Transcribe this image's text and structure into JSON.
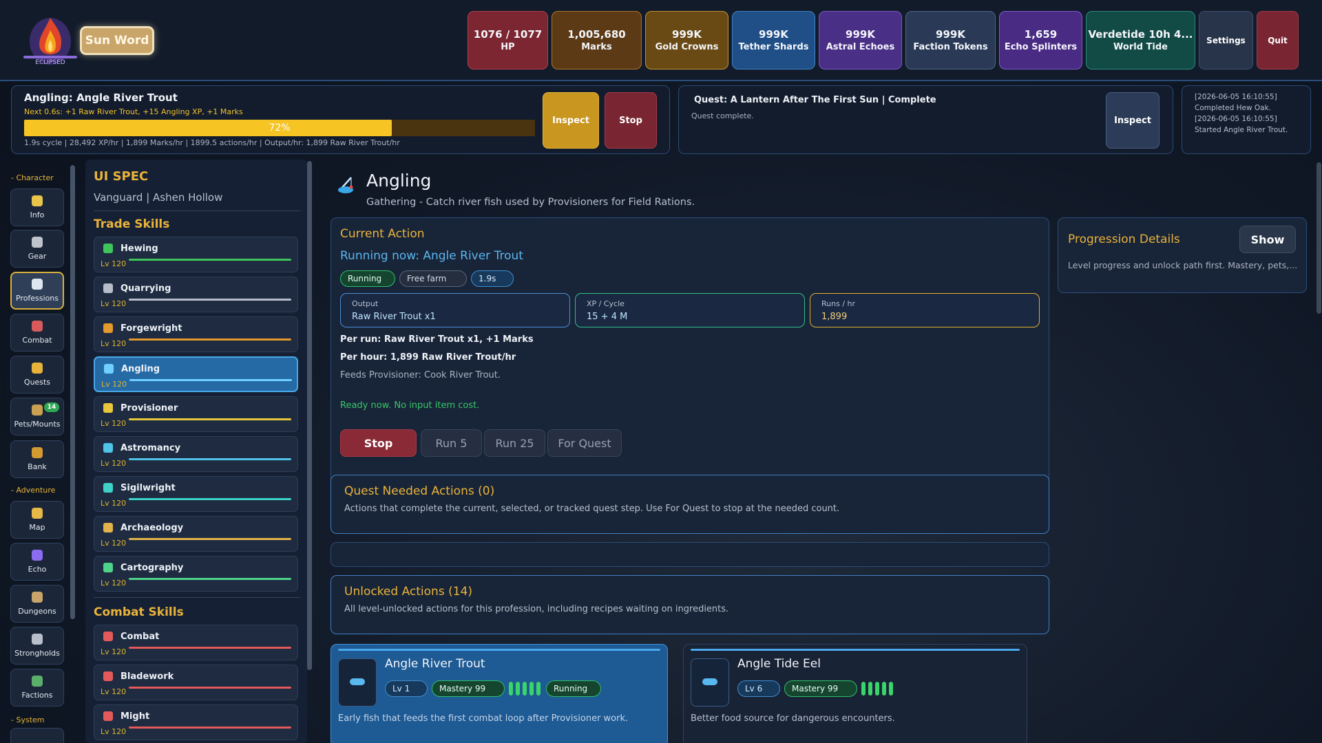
{
  "top": {
    "flame_caption": "ECLIPSED",
    "sun_button": "Sun Word",
    "stats": [
      {
        "value": "1076 / 1077",
        "label": "HP",
        "color": "#7b2630",
        "border": "#b0404e"
      },
      {
        "value": "1,005,680",
        "label": "Marks",
        "color": "#5d3a16",
        "border": "#a9742c"
      },
      {
        "value": "999K",
        "label": "Gold Crowns",
        "color": "#6a4a14",
        "border": "#c3922f"
      },
      {
        "value": "999K",
        "label": "Tether Shards",
        "color": "#1f4f86",
        "border": "#3f82c6"
      },
      {
        "value": "999K",
        "label": "Astral Echoes",
        "color": "#4a2f86",
        "border": "#7a56c8"
      },
      {
        "value": "999K",
        "label": "Faction Tokens",
        "color": "#2a3a56",
        "border": "#4e6488"
      },
      {
        "value": "1,659",
        "label": "Echo Splinters",
        "color": "#4a2b84",
        "border": "#7b59c9"
      },
      {
        "value": "Verdetide 10h 4...",
        "label": "World Tide",
        "color": "#124a45",
        "border": "#2b8b7e"
      }
    ],
    "settings": "Settings",
    "quit": "Quit"
  },
  "activity": {
    "title": "Angling: Angle River Trout",
    "next": "Next 0.6s: +1 Raw River Trout, +15 Angling XP, +1 Marks",
    "progress": 0.72,
    "progress_text": "72%",
    "stats": "1.9s cycle | 28,492 XP/hr | 1,899 Marks/hr | 1899.5 actions/hr | Output/hr: 1,899 Raw River Trout/hr",
    "inspect": "Inspect",
    "stop": "Stop"
  },
  "quest": {
    "title": "Quest: A Lantern After The First Sun | Complete",
    "sub": "Quest complete.",
    "inspect": "Inspect"
  },
  "log": [
    "[2026-06-05 16:10:55]",
    "Completed Hew Oak.",
    "[2026-06-05 16:10:55]",
    "Started Angle River Trout."
  ],
  "nav": {
    "character_header": "- Character",
    "adventure_header": "- Adventure",
    "system_header": "- System",
    "character": [
      {
        "label": "Info",
        "icon": "info-icon",
        "color": "#e8c44a"
      },
      {
        "label": "Gear",
        "icon": "gear-icon",
        "color": "#bfc4cc"
      },
      {
        "label": "Professions",
        "icon": "pickaxe-icon",
        "color": "#e0e6ef"
      },
      {
        "label": "Combat",
        "icon": "crossed-swords-icon",
        "color": "#d85a5a"
      },
      {
        "label": "Quests",
        "icon": "scroll-icon",
        "color": "#e7b33a"
      },
      {
        "label": "Pets/Mounts",
        "icon": "paw-icon",
        "color": "#c8a050",
        "badge": "14"
      },
      {
        "label": "Bank",
        "icon": "chest-icon",
        "color": "#d49a32"
      }
    ],
    "adventure": [
      {
        "label": "Map",
        "icon": "map-icon",
        "color": "#e5b847"
      },
      {
        "label": "Echo",
        "icon": "sparkle-icon",
        "color": "#8a6cf0"
      },
      {
        "label": "Dungeons",
        "icon": "skull-icon",
        "color": "#c9a56a"
      },
      {
        "label": "Strongholds",
        "icon": "castle-icon",
        "color": "#b9c0cc"
      },
      {
        "label": "Factions",
        "icon": "flag-icon",
        "color": "#5ab06a"
      }
    ]
  },
  "skills": {
    "heading": "UI SPEC",
    "sub": "Vanguard | Ashen Hollow",
    "trade_header": "Trade Skills",
    "combat_header": "Combat Skills",
    "trade": [
      {
        "name": "Hewing",
        "level": "Lv 120",
        "color": "#3ec65c",
        "icon": "axe-icon"
      },
      {
        "name": "Quarrying",
        "level": "Lv 120",
        "color": "#b6bdc8",
        "icon": "pickaxe-icon"
      },
      {
        "name": "Forgewright",
        "level": "Lv 120",
        "color": "#e49a2c",
        "icon": "hammer-icon"
      },
      {
        "name": "Angling",
        "level": "Lv 120",
        "color": "#6fd0ff",
        "icon": "fishing-rod-icon",
        "selected": true
      },
      {
        "name": "Provisioner",
        "level": "Lv 120",
        "color": "#e8c73a",
        "icon": "pot-icon"
      },
      {
        "name": "Astromancy",
        "level": "Lv 120",
        "color": "#4fc4e8",
        "icon": "star-icon"
      },
      {
        "name": "Sigilwright",
        "level": "Lv 120",
        "color": "#3ed2c8",
        "icon": "sigil-icon"
      },
      {
        "name": "Archaeology",
        "level": "Lv 120",
        "color": "#e2b34a",
        "icon": "shovel-icon"
      },
      {
        "name": "Cartography",
        "level": "Lv 120",
        "color": "#4ed48a",
        "icon": "map-icon"
      }
    ],
    "combat": [
      {
        "name": "Combat",
        "level": "Lv 120",
        "color": "#e45a5a",
        "icon": "crossed-swords-icon"
      },
      {
        "name": "Bladework",
        "level": "Lv 120",
        "color": "#e45a5a",
        "icon": "sword-icon"
      },
      {
        "name": "Might",
        "level": "Lv 120",
        "color": "#e45a5a",
        "icon": "fist-icon"
      }
    ]
  },
  "profession": {
    "title": "Angling",
    "subtitle": "Gathering - Catch river fish used by Provisioners for Field Rations."
  },
  "current": {
    "header": "Current Action",
    "running": "Running now: Angle River Trout",
    "tags": [
      "Running",
      "Free farm",
      "1.9s"
    ],
    "output_label": "Output",
    "output_value": "Raw River Trout x1",
    "xp_label": "XP / Cycle",
    "xp_value": "15 + 4 M",
    "runs_label": "Runs / hr",
    "runs_value": "1,899",
    "per_run": "Per run: Raw River Trout x1, +1 Marks",
    "per_hour": "Per hour: 1,899 Raw River Trout/hr",
    "feeds": "Feeds Provisioner: Cook River Trout.",
    "ready": "Ready now. No input item cost.",
    "buttons": {
      "stop": "Stop",
      "run5": "Run 5",
      "run25": "Run 25",
      "for_quest": "For Quest"
    }
  },
  "progression": {
    "title": "Progression Details",
    "show": "Show",
    "text": "Level progress and unlock path first. Mastery, pets,..."
  },
  "quest_needed": {
    "title": "Quest Needed Actions (0)",
    "text": "Actions that complete the current, selected, or tracked quest step. Use For Quest to stop at the needed count."
  },
  "unlocked": {
    "title": "Unlocked Actions (14)",
    "text": "All level-unlocked actions for this profession, including recipes waiting on ingredients."
  },
  "actions": [
    {
      "name": "Angle River Trout",
      "level": "Lv 1",
      "mastery": "Mastery 99",
      "status": "Running",
      "desc": "Early fish that feeds the first combat loop after Provisioner work.",
      "pips": 5
    },
    {
      "name": "Angle Tide Eel",
      "level": "Lv 6",
      "mastery": "Mastery 99",
      "desc": "Better food source for dangerous encounters.",
      "pips": 5
    }
  ]
}
